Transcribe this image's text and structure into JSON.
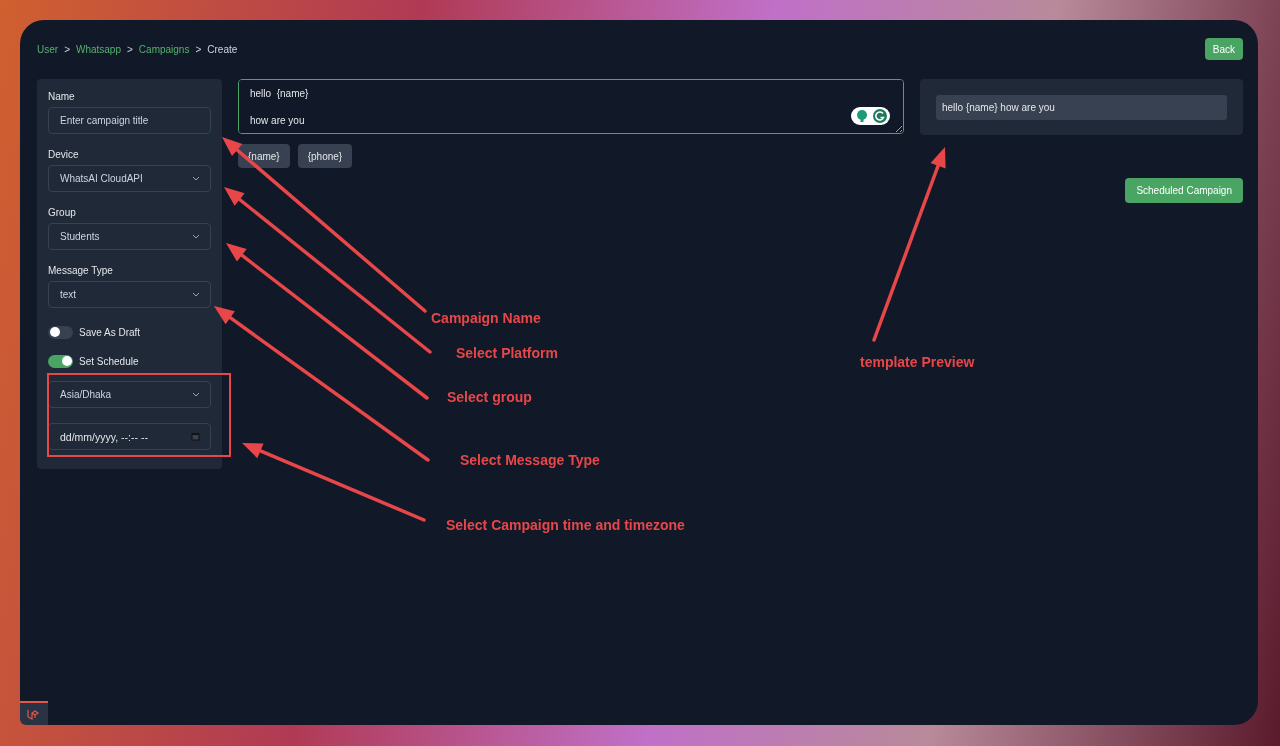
{
  "breadcrumb": {
    "separator": ">",
    "items": [
      {
        "label": "User",
        "link": true
      },
      {
        "label": "Whatsapp",
        "link": true
      },
      {
        "label": "Campaigns",
        "link": true
      },
      {
        "label": "Create",
        "link": false
      }
    ]
  },
  "back_button": "Back",
  "form": {
    "fields": [
      {
        "kind": "text",
        "label": "Name",
        "placeholder": "Enter campaign title"
      },
      {
        "kind": "select",
        "label": "Device",
        "value": "WhatsAI CloudAPI"
      },
      {
        "kind": "select",
        "label": "Group",
        "value": "Students"
      },
      {
        "kind": "select",
        "label": "Message Type",
        "value": "text"
      }
    ],
    "toggles": [
      {
        "label": "Save As Draft",
        "on": false
      },
      {
        "label": "Set Schedule",
        "on": true
      }
    ],
    "schedule": {
      "timezone": "Asia/Dhaka",
      "datetime": "dd/mm/yyyy, --:-- --"
    }
  },
  "message": {
    "text": "hello  {name}\n\nhow are you"
  },
  "variables": [
    "{name}",
    "{phone}"
  ],
  "preview": "hello {name} how are you",
  "submit_button": "Scheduled Campaign",
  "annotations": [
    "Campaign Name",
    "Select Platform",
    "Select group",
    "Select Message Type",
    "Select Campaign time and timezone",
    "template Preview"
  ]
}
